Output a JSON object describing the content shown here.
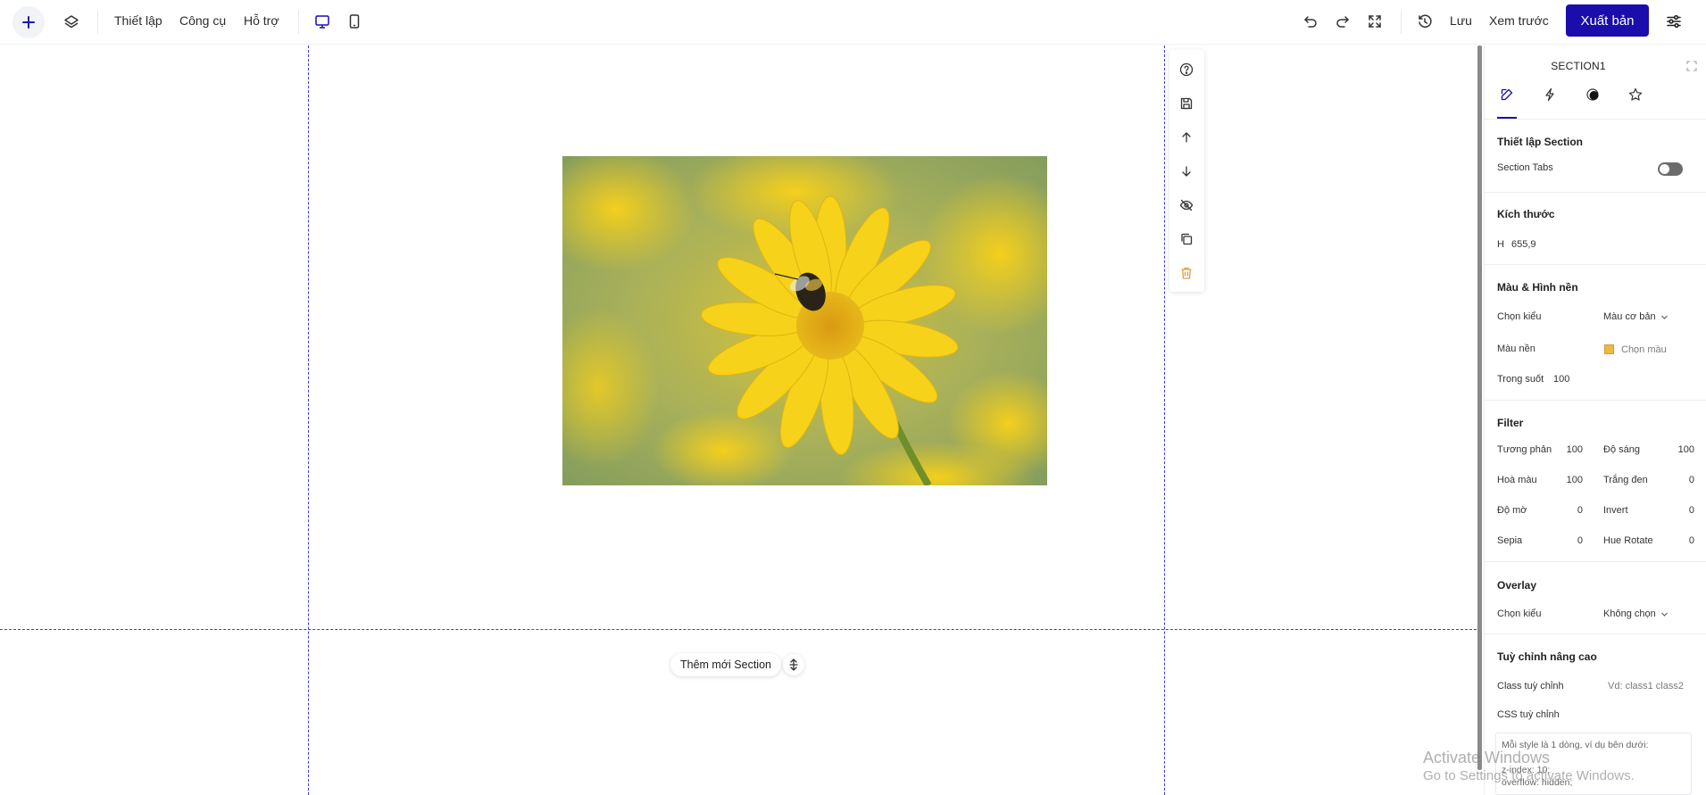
{
  "topbar": {
    "menu": {
      "setup": "Thiết lập",
      "tools": "Công cụ",
      "support": "Hỗ trợ"
    },
    "save_label": "Lưu",
    "preview_label": "Xem trước",
    "publish_label": "Xuất bản"
  },
  "canvas": {
    "add_section_label": "Thêm mới Section",
    "image": {
      "subject": "bee on yellow flower"
    }
  },
  "panel": {
    "title": "SECTION1",
    "section_setup": {
      "title": "Thiết lập Section",
      "tabs_label": "Section Tabs",
      "tabs_enabled": false
    },
    "size": {
      "title": "Kích thước",
      "h_label": "H",
      "h_value": "655,9"
    },
    "background": {
      "title": "Màu & Hình nền",
      "type_label": "Chọn kiểu",
      "type_value": "Màu cơ bản",
      "color_label": "Màu nền",
      "color_value": "Chọn màu",
      "opacity_label": "Trong suốt",
      "opacity_value": "100"
    },
    "filter": {
      "title": "Filter",
      "contrast_label": "Tương phản",
      "contrast_value": "100",
      "brightness_label": "Độ sáng",
      "brightness_value": "100",
      "saturate_label": "Hoà màu",
      "saturate_value": "100",
      "grayscale_label": "Trắng đen",
      "grayscale_value": "0",
      "blur_label": "Độ mờ",
      "blur_value": "0",
      "invert_label": "Invert",
      "invert_value": "0",
      "sepia_label": "Sepia",
      "sepia_value": "0",
      "hue_label": "Hue Rotate",
      "hue_value": "0"
    },
    "overlay": {
      "title": "Overlay",
      "type_label": "Chọn kiểu",
      "type_value": "Không chọn"
    },
    "advanced": {
      "title": "Tuỳ chỉnh nâng cao",
      "class_label": "Class tuỳ chỉnh",
      "class_placeholder": "Vd: class1 class2",
      "css_label": "CSS tuỳ chỉnh",
      "css_hint_1": "Mỗi style là 1 dòng, ví dụ bên dưới:",
      "css_hint_2": "z-index: 10;",
      "css_hint_3": "overflow: hidden;"
    }
  },
  "watermark": {
    "line1": "Activate Windows",
    "line2": "Go to Settings to activate Windows."
  },
  "colors": {
    "accent": "#1a0dab",
    "guide": "#3b3bd6"
  }
}
